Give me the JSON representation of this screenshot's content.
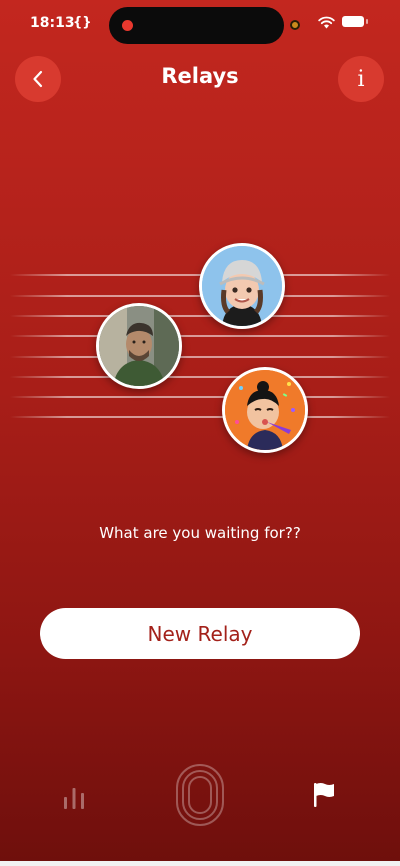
{
  "status_bar": {
    "time": "18:13",
    "dev_icon": "{}"
  },
  "header": {
    "title": "Relays",
    "back_icon": "chevron-left-icon",
    "info_label": "i"
  },
  "relay_avatars": [
    {
      "name": "memoji-avatar",
      "description_icon": "memoji-gray-cap"
    },
    {
      "name": "photo-avatar",
      "description_icon": "person-photo"
    },
    {
      "name": "party-memoji-avatar",
      "description_icon": "memoji-party"
    }
  ],
  "main": {
    "prompt": "What are you waiting for??",
    "new_relay_label": "New Relay"
  },
  "tab_bar": {
    "tabs": [
      {
        "name": "stats",
        "icon": "bar-chart-icon"
      },
      {
        "name": "relay",
        "icon": "track-icon"
      },
      {
        "name": "flag",
        "icon": "flag-icon"
      }
    ]
  },
  "colors": {
    "background_top": "#c3271f",
    "background_bottom": "#6e0f0c",
    "button_bg": "#d83a2f",
    "primary_text_on_button": "#a3211a"
  }
}
